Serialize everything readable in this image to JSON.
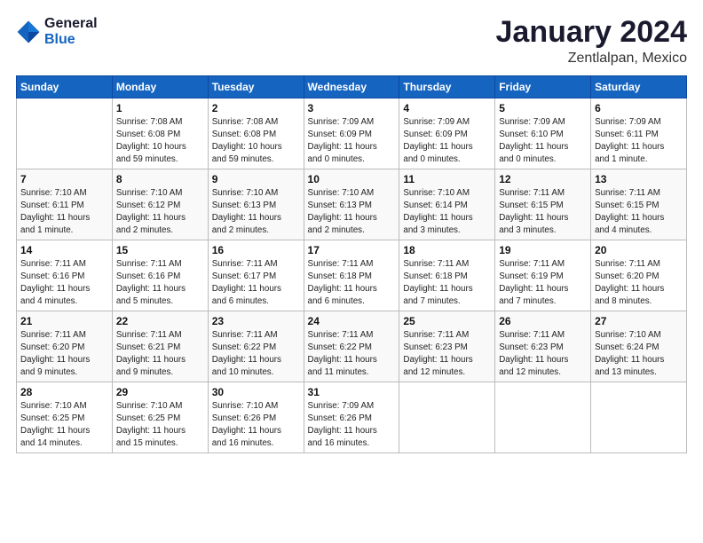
{
  "header": {
    "logo_line1": "General",
    "logo_line2": "Blue",
    "title": "January 2024",
    "subtitle": "Zentlalpan, Mexico"
  },
  "weekdays": [
    "Sunday",
    "Monday",
    "Tuesday",
    "Wednesday",
    "Thursday",
    "Friday",
    "Saturday"
  ],
  "weeks": [
    [
      {
        "day": "",
        "info": ""
      },
      {
        "day": "1",
        "info": "Sunrise: 7:08 AM\nSunset: 6:08 PM\nDaylight: 10 hours\nand 59 minutes."
      },
      {
        "day": "2",
        "info": "Sunrise: 7:08 AM\nSunset: 6:08 PM\nDaylight: 10 hours\nand 59 minutes."
      },
      {
        "day": "3",
        "info": "Sunrise: 7:09 AM\nSunset: 6:09 PM\nDaylight: 11 hours\nand 0 minutes."
      },
      {
        "day": "4",
        "info": "Sunrise: 7:09 AM\nSunset: 6:09 PM\nDaylight: 11 hours\nand 0 minutes."
      },
      {
        "day": "5",
        "info": "Sunrise: 7:09 AM\nSunset: 6:10 PM\nDaylight: 11 hours\nand 0 minutes."
      },
      {
        "day": "6",
        "info": "Sunrise: 7:09 AM\nSunset: 6:11 PM\nDaylight: 11 hours\nand 1 minute."
      }
    ],
    [
      {
        "day": "7",
        "info": "Sunrise: 7:10 AM\nSunset: 6:11 PM\nDaylight: 11 hours\nand 1 minute."
      },
      {
        "day": "8",
        "info": "Sunrise: 7:10 AM\nSunset: 6:12 PM\nDaylight: 11 hours\nand 2 minutes."
      },
      {
        "day": "9",
        "info": "Sunrise: 7:10 AM\nSunset: 6:13 PM\nDaylight: 11 hours\nand 2 minutes."
      },
      {
        "day": "10",
        "info": "Sunrise: 7:10 AM\nSunset: 6:13 PM\nDaylight: 11 hours\nand 2 minutes."
      },
      {
        "day": "11",
        "info": "Sunrise: 7:10 AM\nSunset: 6:14 PM\nDaylight: 11 hours\nand 3 minutes."
      },
      {
        "day": "12",
        "info": "Sunrise: 7:11 AM\nSunset: 6:15 PM\nDaylight: 11 hours\nand 3 minutes."
      },
      {
        "day": "13",
        "info": "Sunrise: 7:11 AM\nSunset: 6:15 PM\nDaylight: 11 hours\nand 4 minutes."
      }
    ],
    [
      {
        "day": "14",
        "info": "Sunrise: 7:11 AM\nSunset: 6:16 PM\nDaylight: 11 hours\nand 4 minutes."
      },
      {
        "day": "15",
        "info": "Sunrise: 7:11 AM\nSunset: 6:16 PM\nDaylight: 11 hours\nand 5 minutes."
      },
      {
        "day": "16",
        "info": "Sunrise: 7:11 AM\nSunset: 6:17 PM\nDaylight: 11 hours\nand 6 minutes."
      },
      {
        "day": "17",
        "info": "Sunrise: 7:11 AM\nSunset: 6:18 PM\nDaylight: 11 hours\nand 6 minutes."
      },
      {
        "day": "18",
        "info": "Sunrise: 7:11 AM\nSunset: 6:18 PM\nDaylight: 11 hours\nand 7 minutes."
      },
      {
        "day": "19",
        "info": "Sunrise: 7:11 AM\nSunset: 6:19 PM\nDaylight: 11 hours\nand 7 minutes."
      },
      {
        "day": "20",
        "info": "Sunrise: 7:11 AM\nSunset: 6:20 PM\nDaylight: 11 hours\nand 8 minutes."
      }
    ],
    [
      {
        "day": "21",
        "info": "Sunrise: 7:11 AM\nSunset: 6:20 PM\nDaylight: 11 hours\nand 9 minutes."
      },
      {
        "day": "22",
        "info": "Sunrise: 7:11 AM\nSunset: 6:21 PM\nDaylight: 11 hours\nand 9 minutes."
      },
      {
        "day": "23",
        "info": "Sunrise: 7:11 AM\nSunset: 6:22 PM\nDaylight: 11 hours\nand 10 minutes."
      },
      {
        "day": "24",
        "info": "Sunrise: 7:11 AM\nSunset: 6:22 PM\nDaylight: 11 hours\nand 11 minutes."
      },
      {
        "day": "25",
        "info": "Sunrise: 7:11 AM\nSunset: 6:23 PM\nDaylight: 11 hours\nand 12 minutes."
      },
      {
        "day": "26",
        "info": "Sunrise: 7:11 AM\nSunset: 6:23 PM\nDaylight: 11 hours\nand 12 minutes."
      },
      {
        "day": "27",
        "info": "Sunrise: 7:10 AM\nSunset: 6:24 PM\nDaylight: 11 hours\nand 13 minutes."
      }
    ],
    [
      {
        "day": "28",
        "info": "Sunrise: 7:10 AM\nSunset: 6:25 PM\nDaylight: 11 hours\nand 14 minutes."
      },
      {
        "day": "29",
        "info": "Sunrise: 7:10 AM\nSunset: 6:25 PM\nDaylight: 11 hours\nand 15 minutes."
      },
      {
        "day": "30",
        "info": "Sunrise: 7:10 AM\nSunset: 6:26 PM\nDaylight: 11 hours\nand 16 minutes."
      },
      {
        "day": "31",
        "info": "Sunrise: 7:09 AM\nSunset: 6:26 PM\nDaylight: 11 hours\nand 16 minutes."
      },
      {
        "day": "",
        "info": ""
      },
      {
        "day": "",
        "info": ""
      },
      {
        "day": "",
        "info": ""
      }
    ]
  ]
}
